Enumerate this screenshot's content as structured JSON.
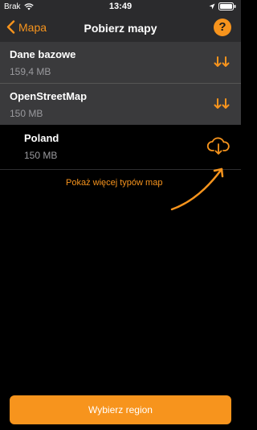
{
  "status_bar": {
    "carrier": "Brak",
    "time": "13:49"
  },
  "nav": {
    "back_label": "Mapa",
    "title": "Pobierz mapy",
    "help_label": "?"
  },
  "items": [
    {
      "name": "Dane bazowe",
      "size": "159,4 MB"
    },
    {
      "name": "OpenStreetMap",
      "size": "150 MB"
    }
  ],
  "country": {
    "name": "Poland",
    "size": "150 MB"
  },
  "more_link": "Pokaż więcej typów map",
  "cta_label": "Wybierz region",
  "colors": {
    "accent": "#f7941d",
    "bar": "#2b2b2d",
    "row": "#3a3a3c",
    "background": "#000000"
  }
}
